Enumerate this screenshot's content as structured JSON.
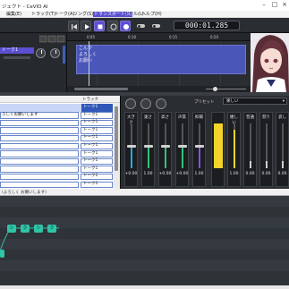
{
  "window": {
    "title": "ジェクト - CeVIO AI"
  },
  "menu": {
    "items": [
      "編集(E)",
      "トラック(T)",
      "トーク(A)",
      "ソング(S)",
      "トランスポート(R)",
      "ツール(L)",
      "ヘルプ(H)"
    ],
    "active_index": 4
  },
  "toolbar": {
    "timecode": "000:01.285"
  },
  "track": {
    "name": "トーク1"
  },
  "timeline": {
    "ticks": [
      "0:05",
      "0:10",
      "0:15",
      "0:20"
    ],
    "clip_lines": [
      "こんや",
      "よろしく",
      "お願い"
    ]
  },
  "table": {
    "header_track": "トラック",
    "rows": [
      {
        "text": "",
        "track": "トーク1"
      },
      {
        "text": "ろしくお願いします",
        "track": "トーク1"
      },
      {
        "text": "",
        "track": "トーク1"
      },
      {
        "text": "",
        "track": "トーク1"
      },
      {
        "text": "",
        "track": "トーク1"
      },
      {
        "text": "",
        "track": "トーク1"
      },
      {
        "text": "",
        "track": "トーク1"
      },
      {
        "text": "",
        "track": "トーク1"
      },
      {
        "text": "",
        "track": "トーク1"
      },
      {
        "text": "",
        "track": "トーク1"
      },
      {
        "text": "",
        "track": "トーク1"
      }
    ],
    "selected_row": 0
  },
  "mixer": {
    "preset_label": "プリセット",
    "preset_value": "楽しい",
    "params": [
      {
        "label": "大きさ",
        "value": "+0.00",
        "level": 0.5,
        "color": "#29a8e0"
      },
      {
        "label": "速さ",
        "value": "1.00",
        "level": 0.5,
        "color": "#37c07a"
      },
      {
        "label": "高さ",
        "value": "+0.00",
        "level": 0.5,
        "color": "#37c07a"
      },
      {
        "label": "声質",
        "value": "+0.00",
        "level": 0.5,
        "color": "#37c07a"
      },
      {
        "label": "抑揚",
        "value": "1.00",
        "level": 0.5,
        "color": "#8a4fd8"
      }
    ],
    "emotions": [
      {
        "label": "",
        "value": "",
        "level": 1.0,
        "color": "#f3d42a"
      },
      {
        "label": "嬉しい",
        "value": "1.00",
        "level": 0.85,
        "color": "#f3d42a"
      },
      {
        "label": "普通",
        "value": "0.00",
        "level": 0.15,
        "color": "#cfcfcf"
      },
      {
        "label": "怒り",
        "value": "0.00",
        "level": 0.15,
        "color": "#cfcfcf"
      },
      {
        "label": "哀し",
        "value": "0.00",
        "level": 0.15,
        "color": "#cfcfcf"
      }
    ]
  },
  "pitch": {
    "header": "(よろしく お願いします)",
    "notes": [
      "シ",
      "ク",
      "シ",
      "ク"
    ]
  },
  "colors": {
    "accent": "#5a4fd0",
    "note": "#2fc4a8"
  }
}
